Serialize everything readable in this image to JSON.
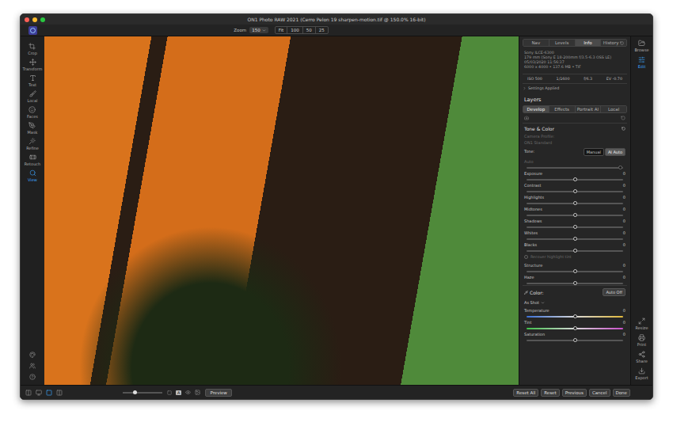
{
  "window": {
    "title": "ON1 Photo RAW 2021 (Cerro Pelon 19 sharpen-motion.tif @ 150.0% 16-bit)"
  },
  "toolbar": {
    "zoomLabel": "Zoom",
    "zoomValue": "150",
    "zoomButtons": [
      "Fit",
      "100",
      "50",
      "25"
    ]
  },
  "tools": [
    {
      "label": "Crop",
      "selected": false
    },
    {
      "label": "Transform",
      "selected": false
    },
    {
      "label": "Text",
      "selected": false
    },
    {
      "label": "Local",
      "selected": false
    },
    {
      "label": "Faces",
      "selected": false
    },
    {
      "label": "Mask",
      "selected": false
    },
    {
      "label": "Refine",
      "selected": false
    },
    {
      "label": "Retouch",
      "selected": false
    },
    {
      "label": "View",
      "selected": true
    }
  ],
  "modules": {
    "top": [
      {
        "label": "Browse",
        "selected": false
      },
      {
        "label": "Edit",
        "selected": true
      }
    ],
    "bottom": [
      "Resize",
      "Print",
      "Share",
      "Export"
    ]
  },
  "panelTabs": [
    {
      "label": "Nav",
      "selected": false
    },
    {
      "label": "Levels",
      "selected": false
    },
    {
      "label": "Info",
      "selected": true
    },
    {
      "label": "History",
      "selected": false
    }
  ],
  "info": {
    "lines": [
      "Sony ILCE-6300",
      "179 mm (Sony E 18-200mm f/3.5-6.3 OSS LE)",
      "05/03/2020 11:56:37",
      "6000 x 4000 • 137.6 MB • TIF"
    ],
    "exif": [
      "ISO 500",
      "1/1600",
      "f/6.3",
      "EV -0.70"
    ],
    "settings": {
      "label": "Settings Applied",
      "expanded": false
    }
  },
  "layers": {
    "title": "Layers",
    "tabs": [
      {
        "label": "Develop",
        "selected": true
      },
      {
        "label": "Effects",
        "selected": false
      },
      {
        "label": "Portrait AI",
        "selected": false
      },
      {
        "label": "Local",
        "selected": false
      }
    ]
  },
  "tone": {
    "title": "Tone & Color",
    "profileLabel": "Camera Profile:",
    "profileValue": "ON1 Standard",
    "profileDisabled": true,
    "toneLabel": "Tone:",
    "modes": [
      {
        "label": "Manual",
        "selected": false
      },
      {
        "label": "AI Auto",
        "selected": true
      }
    ],
    "auto": {
      "label": "Auto",
      "level": 0.97,
      "disabled": true
    },
    "sliders": [
      {
        "label": "Exposure",
        "value": "0",
        "level": 0.5
      },
      {
        "label": "Contrast",
        "value": "0",
        "level": 0.5
      },
      {
        "label": "Highlights",
        "value": "0",
        "level": 0.5
      },
      {
        "label": "Midtones",
        "value": "0",
        "level": 0.5
      },
      {
        "label": "Shadows",
        "value": "0",
        "level": 0.5
      },
      {
        "label": "Whites",
        "value": "0",
        "level": 0.5
      },
      {
        "label": "Blacks",
        "value": "0",
        "level": 0.5
      }
    ],
    "recover": {
      "label": "Recover highlight tint",
      "checked": false,
      "disabled": true
    },
    "sliders2": [
      {
        "label": "Structure",
        "value": "0",
        "level": 0.5
      },
      {
        "label": "Haze",
        "value": "0",
        "level": 0.5
      }
    ]
  },
  "color": {
    "label": "Color:",
    "autoButton": "Auto Off",
    "preset": "As Shot",
    "sliders": [
      {
        "label": "Temperature",
        "value": "0",
        "level": 0.5,
        "kind": "temperature"
      },
      {
        "label": "Tint",
        "value": "0",
        "level": 0.5,
        "kind": "tint"
      },
      {
        "label": "Saturation",
        "value": "0",
        "level": 0.5,
        "kind": "plain"
      }
    ]
  },
  "bottom": {
    "zoomLevel": 0.3,
    "aLabel": "A",
    "preview": "Preview",
    "actions": [
      "Reset All",
      "Reset",
      "Previous",
      "Cancel",
      "Done"
    ]
  }
}
